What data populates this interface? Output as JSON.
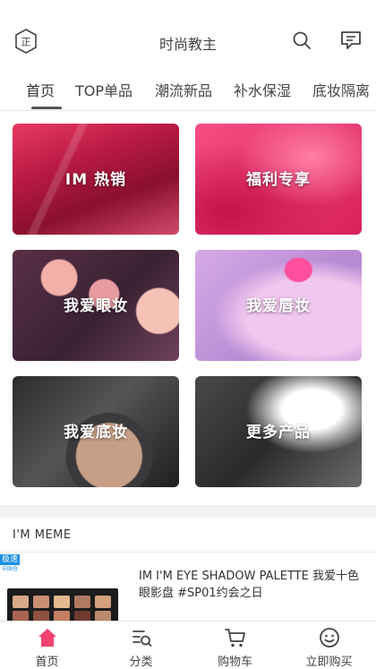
{
  "header": {
    "title": "时尚教主",
    "logo_text": "正"
  },
  "tabs": [
    {
      "label": "首页"
    },
    {
      "label": "TOP单品"
    },
    {
      "label": "潮流新品"
    },
    {
      "label": "补水保湿"
    },
    {
      "label": "底妆隔离"
    }
  ],
  "categories": [
    {
      "label": "IM 热销"
    },
    {
      "label": "福利专享"
    },
    {
      "label": "我爱眼妆"
    },
    {
      "label": "我爱唇妆"
    },
    {
      "label": "我爱底妆"
    },
    {
      "label": "更多产品"
    }
  ],
  "brand_section": {
    "title": "I'M MEME",
    "product": {
      "badge_top": "极速",
      "badge_bottom": "中国仓",
      "name": "IM I'M EYE SHADOW PALETTE 我爱十色眼影盘 #SP01约会之日"
    }
  },
  "bottom_nav": [
    {
      "label": "首页",
      "icon": "home-icon"
    },
    {
      "label": "分类",
      "icon": "category-icon"
    },
    {
      "label": "购物车",
      "icon": "cart-icon"
    },
    {
      "label": "立即购买",
      "icon": "smile-icon"
    }
  ],
  "colors": {
    "accent": "#f0426e",
    "badge": "#1a8fe3"
  }
}
